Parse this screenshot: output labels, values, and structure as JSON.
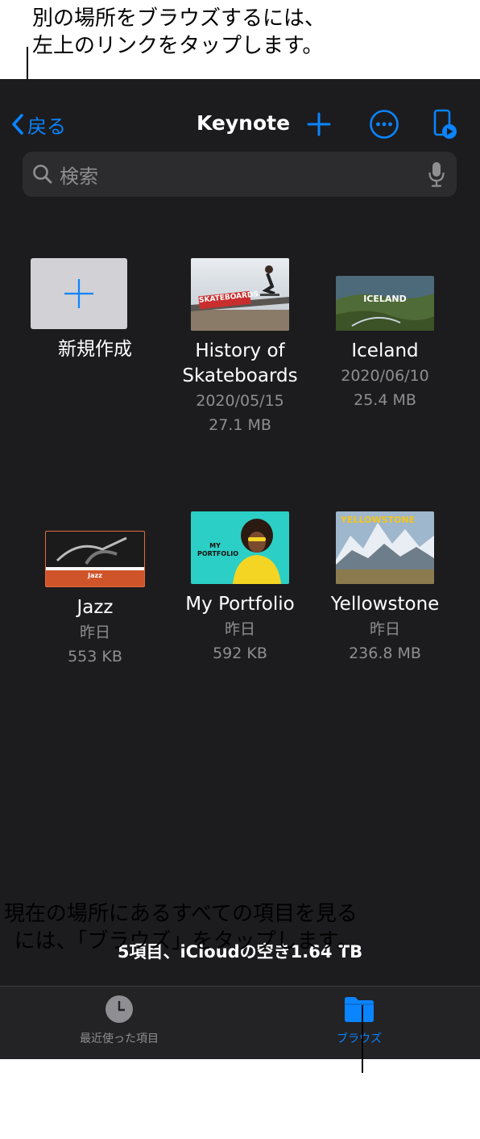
{
  "callouts": {
    "top_line1": "別の場所をブラウズするには、",
    "top_line2": "左上のリンクをタップします。",
    "bottom_line1": "現在の場所にあるすべての項目を見る",
    "bottom_line2": "には、「ブラウズ」をタップします。"
  },
  "nav": {
    "back_label": "戻る",
    "title": "Keynote",
    "icons": [
      "chevron-left-icon",
      "plus-icon",
      "more-circle-icon",
      "play-remote-icon"
    ]
  },
  "search": {
    "placeholder": "検索",
    "icons": [
      "magnifier-icon",
      "mic-icon"
    ]
  },
  "new_item": {
    "label": "新規作成"
  },
  "documents": [
    {
      "name_line1": "History of",
      "name_line2": "Skateboards",
      "date": "2020/05/15",
      "size": "27.1 MB",
      "thumb_text": "SKATEBOARDS"
    },
    {
      "name_line1": "Iceland",
      "date": "2020/06/10",
      "size": "25.4 MB",
      "thumb_text": "ICELAND"
    },
    {
      "name_line1": "Jazz",
      "date": "昨日",
      "size": "553 KB",
      "thumb_text": "Jazz"
    },
    {
      "name_line1": "My Portfolio",
      "date": "昨日",
      "size": "592 KB",
      "thumb_text": "MY PORTFOLIO"
    },
    {
      "name_line1": "Yellowstone",
      "date": "昨日",
      "size": "236.8 MB",
      "thumb_text": "YELLOWSTONE"
    }
  ],
  "storage": {
    "text": "5項目、iCloudの空き1.64 TB"
  },
  "tabbar": {
    "tabs": [
      {
        "label": "最近使った項目",
        "icon": "clock-icon",
        "active": false
      },
      {
        "label": "ブラウズ",
        "icon": "folder-icon",
        "active": true
      }
    ]
  },
  "colors": {
    "accent": "#0a84ff",
    "background": "#1c1c1e",
    "search_bg": "#2c2c2e",
    "secondary_text": "#8e8e93",
    "tabbar_bg": "#232325"
  }
}
